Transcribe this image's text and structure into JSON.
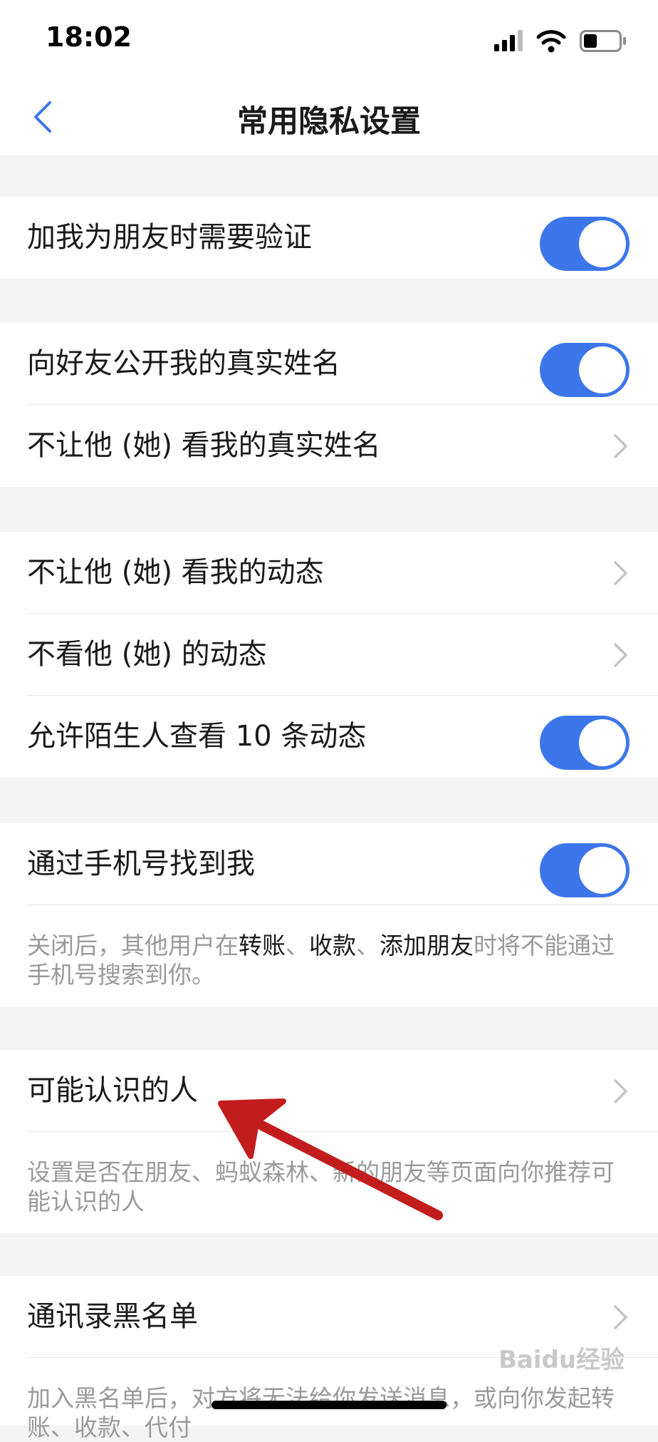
{
  "colors": {
    "accent": "#3c76ea",
    "background": "#f4f4f4",
    "chevron": "#c4c4c4",
    "annotation_arrow": "#c21d1d"
  },
  "status_bar": {
    "time": "18:02",
    "icons": [
      "signal-icon",
      "wifi-icon",
      "battery-icon"
    ]
  },
  "nav": {
    "title": "常用隐私设置",
    "back_icon": "chevron-left-icon"
  },
  "settings": {
    "verify_friend": {
      "label": "加我为朋友时需要验证",
      "toggle_on": true
    },
    "show_real_name": {
      "label": "向好友公开我的真实姓名",
      "toggle_on": true
    },
    "hide_name_from": {
      "label": "不让他 (她) 看我的真实姓名"
    },
    "hide_moments_from": {
      "label": "不让他 (她) 看我的动态"
    },
    "dont_view_moments": {
      "label": "不看他 (她) 的动态"
    },
    "stranger_view_10": {
      "label": "允许陌生人查看 10 条动态",
      "toggle_on": true
    },
    "find_by_phone": {
      "label": "通过手机号找到我",
      "toggle_on": true
    },
    "phone_desc": {
      "part1": "关闭后，其他用户在",
      "hl1": "转账",
      "sep1": "、",
      "hl2": "收款",
      "sep2": "、",
      "hl3": "添加朋友",
      "part2": "时将不能通过手机号搜索到你。"
    },
    "people_you_may_know": {
      "label": "可能认识的人"
    },
    "pymk_desc": "设置是否在朋友、蚂蚁森林、新的朋友等页面向你推荐可能认识的人",
    "contacts_blacklist": {
      "label": "通讯录黑名单"
    },
    "blacklist_desc": "加入黑名单后，对方将无法给你发送消息，或向你发起转账、收款、代付"
  },
  "watermark": "Baidu经验"
}
